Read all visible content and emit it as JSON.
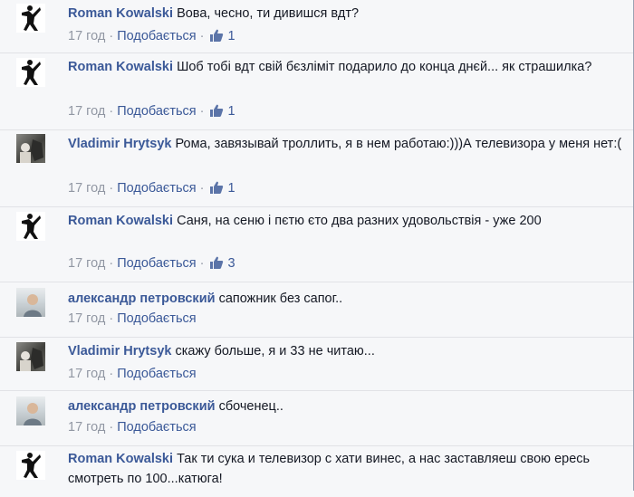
{
  "comments": [
    {
      "author": "Roman Kowalski",
      "avatar": "banksy-flower-thrower-avatar",
      "text": "Вова, чесно, ти дивишся вдт?",
      "time": "17 год",
      "like_label": "Подобається",
      "likes": "1"
    },
    {
      "author": "Roman Kowalski",
      "avatar": "banksy-flower-thrower-avatar",
      "text": "Шоб тобі вдт свій бєзліміт подарило до конца днєй... як страшилка?",
      "time": "17 год",
      "like_label": "Подобається",
      "likes": "1"
    },
    {
      "author": "Vladimir Hrytsyk",
      "avatar": "photo-avatar",
      "text": "Рома, завязывай троллить, я в нем работаю:)))А телевизора у меня нет:(",
      "time": "17 год",
      "like_label": "Подобається",
      "likes": "1"
    },
    {
      "author": "Roman Kowalski",
      "avatar": "banksy-flower-thrower-avatar",
      "text": "Саня, на сеню і пєтю єто два разних удовольствія - уже 200",
      "time": "17 год",
      "like_label": "Подобається",
      "likes": "3"
    },
    {
      "author": "александр петровский",
      "avatar": "photo-avatar",
      "text": "сапожник без сапог..",
      "time": "17 год",
      "like_label": "Подобається"
    },
    {
      "author": "Vladimir Hrytsyk",
      "avatar": "photo-avatar",
      "text": "скажу больше, я и 33 не читаю...",
      "time": "17 год",
      "like_label": "Подобається"
    },
    {
      "author": "александр петровский",
      "avatar": "photo-avatar",
      "text": "сбоченец..",
      "time": "17 год",
      "like_label": "Подобається"
    },
    {
      "author": "Roman Kowalski",
      "avatar": "banksy-flower-thrower-avatar",
      "text": "Так ти сука и телевизор с хати винес, а нас заставляеш свою ересь смотреть по 100...катюга!"
    }
  ],
  "colors": {
    "author": "#3b5998",
    "meta": "#9197a3",
    "background": "#f6f7f9"
  }
}
